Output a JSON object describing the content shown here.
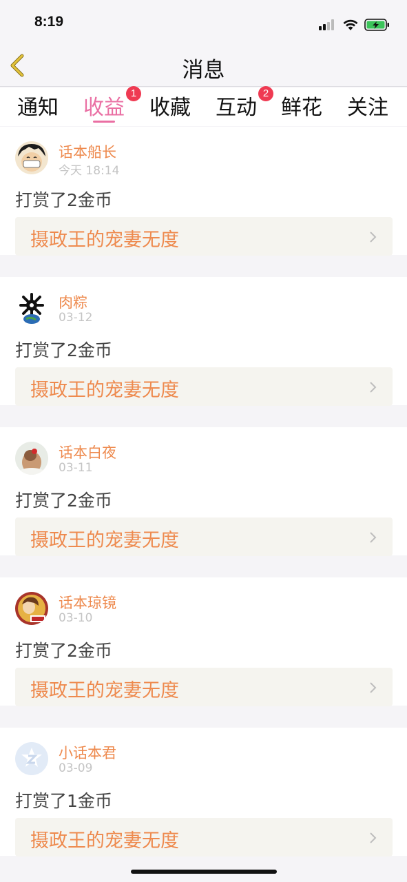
{
  "status_bar": {
    "time": "8:19",
    "icons": [
      "signal-icon",
      "wifi-icon",
      "battery-charging-icon"
    ]
  },
  "nav": {
    "title": "消息",
    "back_icon": "chevron-left-icon"
  },
  "tabs": [
    {
      "label": "通知",
      "badge": null,
      "active": false
    },
    {
      "label": "收益",
      "badge": "1",
      "active": true
    },
    {
      "label": "收藏",
      "badge": null,
      "active": false
    },
    {
      "label": "互动",
      "badge": "2",
      "active": false
    },
    {
      "label": "鲜花",
      "badge": null,
      "active": false
    },
    {
      "label": "关注",
      "badge": null,
      "active": false
    }
  ],
  "messages": [
    {
      "username": "话本船长",
      "time": "今天 18:14",
      "text": "打赏了2金币",
      "book": "摄政王的宠妻无度"
    },
    {
      "username": "肉粽",
      "time": "03-12",
      "text": "打赏了2金币",
      "book": "摄政王的宠妻无度"
    },
    {
      "username": "话本白夜",
      "time": "03-11",
      "text": "打赏了2金币",
      "book": "摄政王的宠妻无度"
    },
    {
      "username": "话本琼镜",
      "time": "03-10",
      "text": "打赏了2金币",
      "book": "摄政王的宠妻无度"
    },
    {
      "username": "小话本君",
      "time": "03-09",
      "text": "打赏了1金币",
      "book": "摄政王的宠妻无度"
    }
  ],
  "colors": {
    "accent_pink": "#ea6fa3",
    "accent_orange": "#ee8a4e",
    "badge_red": "#ef3a52",
    "back_yellow": "#d9b52c"
  }
}
